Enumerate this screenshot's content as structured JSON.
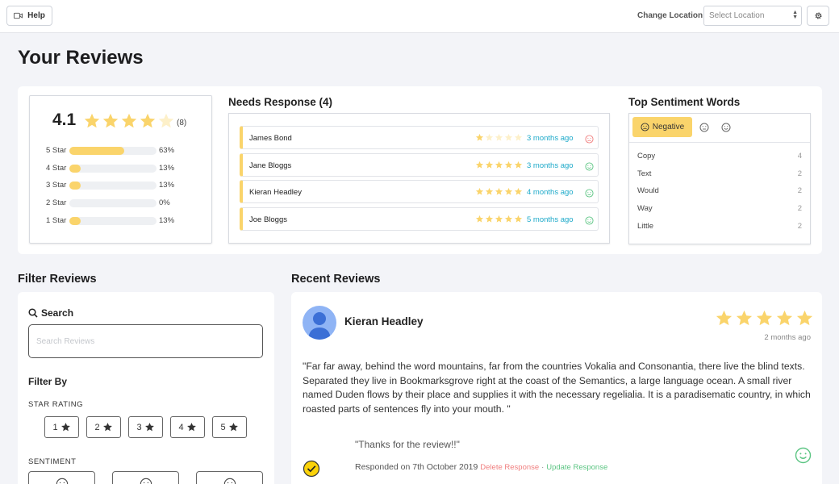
{
  "topbar": {
    "help_label": "Help",
    "location_label": "Change Location:",
    "location_placeholder": "Select Location"
  },
  "page_title": "Your Reviews",
  "summary": {
    "average": "4.1",
    "average_stars": 4,
    "count": "(8)",
    "distribution": [
      {
        "label": "5 Star",
        "fraction": 0.63,
        "pct": "63%"
      },
      {
        "label": "4 Star",
        "fraction": 0.13,
        "pct": "13%"
      },
      {
        "label": "3 Star",
        "fraction": 0.13,
        "pct": "13%"
      },
      {
        "label": "2 Star",
        "fraction": 0.0,
        "pct": "0%"
      },
      {
        "label": "1 Star",
        "fraction": 0.13,
        "pct": "13%"
      }
    ]
  },
  "needs_response": {
    "title": "Needs Response (4)",
    "items": [
      {
        "name": "James Bond",
        "stars": 1,
        "ago": "3 months ago",
        "sentiment": "negative"
      },
      {
        "name": "Jane Bloggs",
        "stars": 5,
        "ago": "3 months ago",
        "sentiment": "positive"
      },
      {
        "name": "Kieran Headley",
        "stars": 5,
        "ago": "4 months ago",
        "sentiment": "positive"
      },
      {
        "name": "Joe Bloggs",
        "stars": 5,
        "ago": "5 months ago",
        "sentiment": "positive"
      }
    ]
  },
  "sentiment_words": {
    "title": "Top Sentiment Words",
    "active_tab": "Negative",
    "words": [
      {
        "word": "Copy",
        "count": "4"
      },
      {
        "word": "Text",
        "count": "2"
      },
      {
        "word": "Would",
        "count": "2"
      },
      {
        "word": "Way",
        "count": "2"
      },
      {
        "word": "Little",
        "count": "2"
      }
    ]
  },
  "filter": {
    "title": "Filter Reviews",
    "search_label": "Search",
    "search_placeholder": "Search Reviews",
    "filter_by": "Filter By",
    "star_rating_label": "STAR RATING",
    "star_buttons": [
      "1",
      "2",
      "3",
      "4",
      "5"
    ],
    "sentiment_label": "SENTIMENT"
  },
  "recent": {
    "title": "Recent Reviews",
    "reviewer": "Kieran Headley",
    "stars": 5,
    "ago": "2 months ago",
    "text": "\"Far far away, behind the word mountains, far from the countries Vokalia and Consonantia, there live the blind texts. Separated they live in Bookmarksgrove right at the coast of the Semantics, a large language ocean. A small river named Duden flows by their place and supplies it with the necessary regelialia. It is a paradisematic country, in which roasted parts of sentences fly into your mouth. \"",
    "response": "\"Thanks for the review!!\"",
    "responded_on": "Responded on 7th October 2019",
    "delete_label": "Delete Response",
    "update_label": "Update Response",
    "separator": "·"
  },
  "colors": {
    "star": "#fad46b",
    "accent_cyan": "#1ca9c9",
    "negative": "#f07e7e",
    "positive": "#5cc583"
  }
}
